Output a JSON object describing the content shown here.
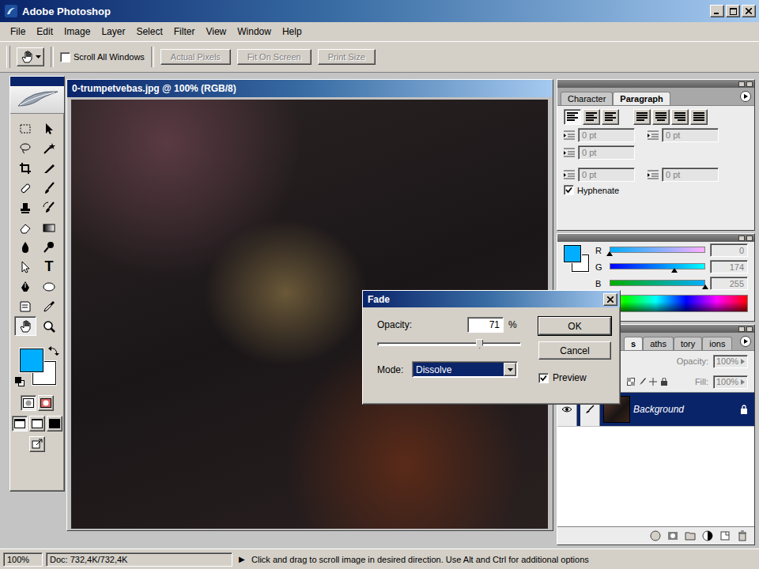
{
  "window": {
    "title": "Adobe Photoshop"
  },
  "menu": [
    "File",
    "Edit",
    "Image",
    "Layer",
    "Select",
    "Filter",
    "View",
    "Window",
    "Help"
  ],
  "options_bar": {
    "scroll_all_windows": {
      "label": "Scroll All Windows",
      "checked": false
    },
    "buttons": [
      {
        "label": "Actual Pixels",
        "disabled": true
      },
      {
        "label": "Fit On Screen",
        "disabled": true
      },
      {
        "label": "Print Size",
        "disabled": true
      }
    ]
  },
  "toolbox": {
    "tools": [
      {
        "selected": false
      },
      {
        "selected": false
      },
      {
        "selected": false
      },
      {
        "selected": false
      },
      {
        "selected": false
      },
      {
        "selected": false
      },
      {
        "selected": false
      },
      {
        "selected": false
      },
      {
        "selected": false
      },
      {
        "selected": false
      },
      {
        "selected": false
      },
      {
        "selected": false
      },
      {
        "selected": false
      },
      {
        "selected": false
      },
      {
        "selected": false
      },
      {
        "selected": false,
        "glyph": "T"
      },
      {
        "selected": false
      },
      {
        "selected": false
      },
      {
        "selected": false
      },
      {
        "selected": false
      },
      {
        "selected": true
      },
      {
        "selected": false
      }
    ],
    "quick_mask": [
      {
        "selected": true
      },
      {
        "selected": false
      }
    ],
    "screen_modes": [
      {
        "selected": true
      },
      {
        "selected": false
      },
      {
        "selected": false
      }
    ]
  },
  "colors": {
    "foreground": "#00aeff",
    "background": "#ffffff"
  },
  "document": {
    "title": "0-trumpetvebas.jpg @ 100% (RGB/8)"
  },
  "paragraph_panel": {
    "tabs": [
      {
        "label": "Character",
        "selected": false
      },
      {
        "label": "Paragraph",
        "selected": true
      }
    ],
    "alignment": [
      {
        "selected": true
      },
      {
        "selected": false
      },
      {
        "selected": false
      },
      {
        "selected": false
      },
      {
        "selected": false
      },
      {
        "selected": false
      },
      {
        "selected": false
      }
    ],
    "fields": [
      {
        "value": "0 pt",
        "disabled": true
      },
      {
        "value": "0 pt",
        "disabled": true
      },
      {
        "value": "0 pt",
        "disabled": true
      },
      {
        "value": "0 pt",
        "disabled": true
      },
      {
        "value": "0 pt",
        "disabled": true
      }
    ],
    "hyphenate": {
      "label": "Hyphenate",
      "checked": true
    }
  },
  "color_panel": {
    "channels": [
      {
        "name": "R",
        "value": "0",
        "level": 0
      },
      {
        "name": "G",
        "value": "174",
        "level": 0.68
      },
      {
        "name": "B",
        "value": "255",
        "level": 1
      }
    ]
  },
  "layers_panel": {
    "tabs": [
      {
        "label": "s",
        "selected": true
      },
      {
        "label": "aths",
        "selected": false
      },
      {
        "label": "tory",
        "selected": false
      },
      {
        "label": "ions",
        "selected": false
      }
    ],
    "opacity": {
      "label": "Opacity:",
      "value": "100%"
    },
    "fill": {
      "label": "Fill:",
      "value": "100%"
    },
    "layers": [
      {
        "name": "Background",
        "visible": true,
        "selected": true,
        "locked": true
      }
    ]
  },
  "fade_dialog": {
    "title": "Fade",
    "opacity": {
      "label": "Opacity:",
      "value": "71",
      "unit": "%",
      "level": 0.71
    },
    "mode": {
      "label": "Mode:",
      "value": "Dissolve"
    },
    "buttons": [
      "OK",
      "Cancel"
    ],
    "preview": {
      "label": "Preview",
      "checked": true
    }
  },
  "status_bar": {
    "zoom": "100%",
    "doc": "Doc: 732,4K/732,4K",
    "arrow": "▶",
    "message": "Click and drag to scroll image in desired direction.  Use Alt and Ctrl for additional options"
  }
}
